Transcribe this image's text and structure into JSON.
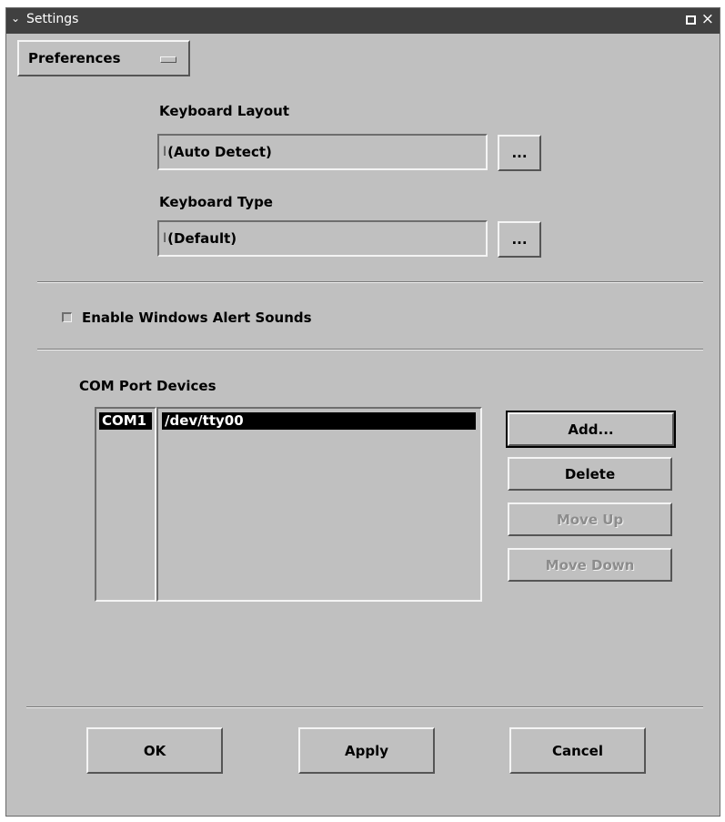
{
  "window": {
    "title": "Settings",
    "title_menu_icon": "chevron-down-icon",
    "maximize_icon": "maximize-icon",
    "close_icon": "close-icon"
  },
  "preferences_menu": {
    "label": "Preferences"
  },
  "keyboard": {
    "layout_label": "Keyboard Layout",
    "layout_value": "(Auto Detect)",
    "type_label": "Keyboard Type",
    "type_value": "(Default)",
    "browse_label": "..."
  },
  "alert_sounds": {
    "label": "Enable Windows Alert Sounds",
    "checked": false
  },
  "com_ports": {
    "label": "COM Port Devices",
    "rows": [
      {
        "port": "COM1",
        "device": "/dev/tty00",
        "selected": true
      }
    ],
    "buttons": {
      "add": "Add...",
      "delete": "Delete",
      "move_up": "Move Up",
      "move_down": "Move Down"
    }
  },
  "footer": {
    "ok": "OK",
    "apply": "Apply",
    "cancel": "Cancel"
  },
  "colors": {
    "title_bar": "#404040",
    "background": "#c0c0c0",
    "selection": "#000000"
  }
}
